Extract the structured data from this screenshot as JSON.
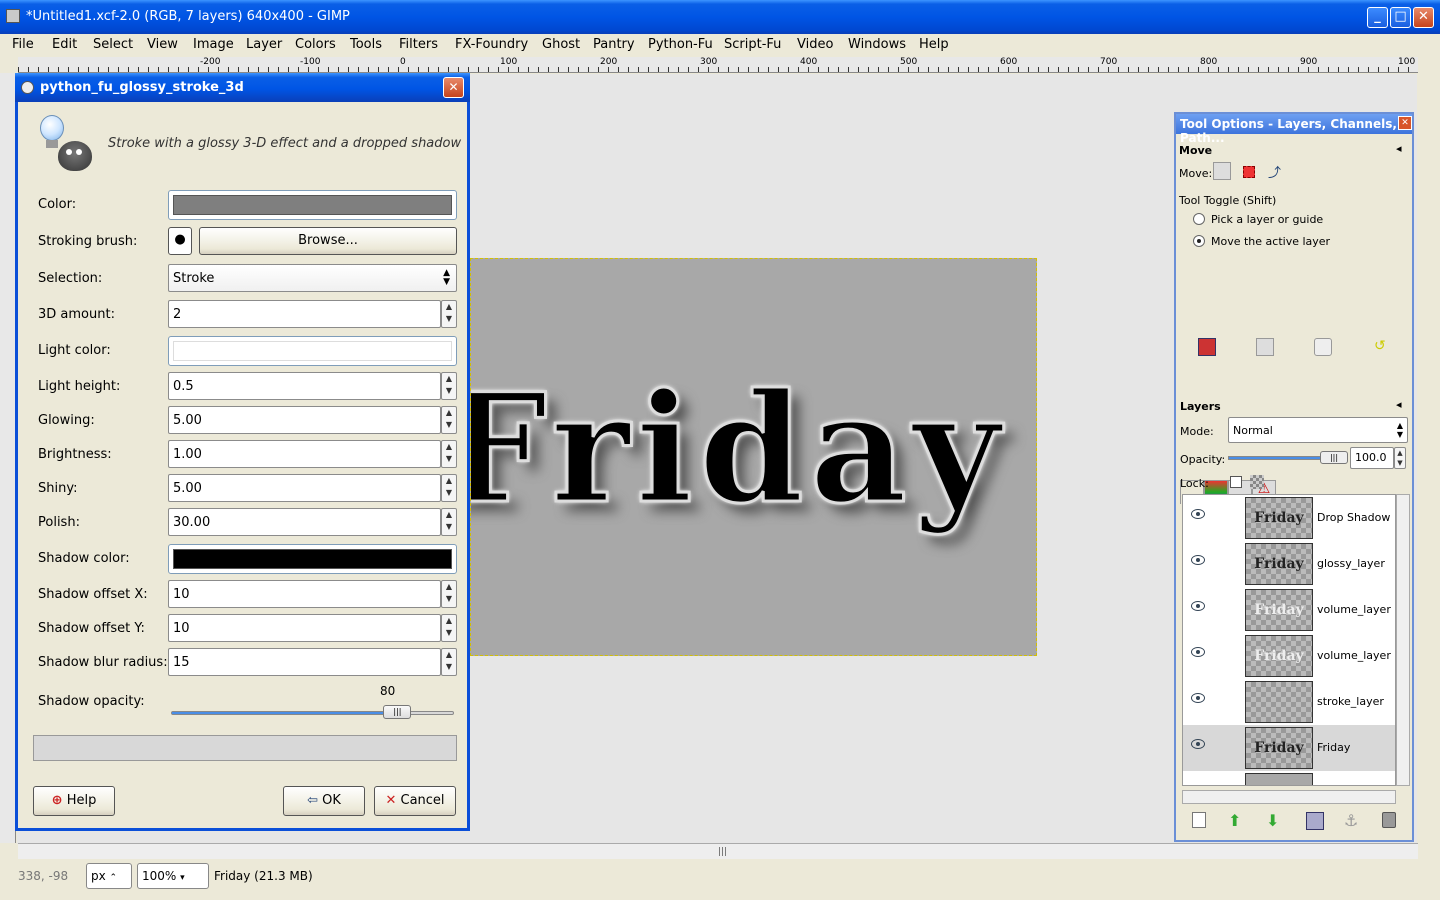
{
  "window": {
    "title": "*Untitled1.xcf-2.0 (RGB, 7 layers) 640x400 - GIMP",
    "min_glyph": "_",
    "max_glyph": "□",
    "close_glyph": "✕"
  },
  "menu": [
    "File",
    "Edit",
    "Select",
    "View",
    "Image",
    "Layer",
    "Colors",
    "Tools",
    "Filters",
    "FX-Foundry",
    "Ghost",
    "Pantry",
    "Python-Fu",
    "Script-Fu",
    "Video",
    "Windows",
    "Help"
  ],
  "ruler": {
    "labels": [
      "-200",
      "-100",
      "0",
      "100",
      "200",
      "300",
      "400",
      "500",
      "600",
      "700",
      "800",
      "900",
      "100"
    ]
  },
  "canvas": {
    "image_text": "Friday"
  },
  "dialog": {
    "title": "python_fu_glossy_stroke_3d",
    "close_glyph": "✕",
    "description": "Stroke with a glossy 3-D effect and a dropped shadow",
    "fields": {
      "color_label": "Color:",
      "color_value": "#7f7f7f",
      "brush_label": "Stroking brush:",
      "brush_dot": "●",
      "browse": "Browse...",
      "selection_label": "Selection:",
      "selection_value": "Stroke",
      "amount_label": "3D amount:",
      "amount_value": "2",
      "light_color_label": "Light color:",
      "light_color_value": "#ffffff",
      "light_height_label": "Light height:",
      "light_height_value": "0.5",
      "glowing_label": "Glowing:",
      "glowing_value": "5.00",
      "brightness_label": "Brightness:",
      "brightness_value": "1.00",
      "shiny_label": "Shiny:",
      "shiny_value": "5.00",
      "polish_label": "Polish:",
      "polish_value": "30.00",
      "shadow_color_label": "Shadow color:",
      "shadow_color_value": "#000000",
      "offset_x_label": "Shadow offset X:",
      "offset_x_value": "10",
      "offset_y_label": "Shadow offset Y:",
      "offset_y_value": "10",
      "blur_label": "Shadow blur radius:",
      "blur_value": "15",
      "opacity_label": "Shadow opacity:",
      "opacity_value": "80",
      "opacity_fraction": 0.8
    },
    "buttons": {
      "help": "Help",
      "ok": "OK",
      "cancel": "Cancel"
    }
  },
  "statusbar": {
    "coords": "338, -98",
    "unit": "px",
    "zoom": "100",
    "zoom_suffix": "%",
    "layer_info": "Friday (21.3 MB)"
  },
  "dock": {
    "title": "Tool Options - Layers, Channels, Path...",
    "close_glyph": "✕",
    "tool_name": "Move",
    "move_label": "Move:",
    "toggle_label": "Tool Toggle  (Shift)",
    "radio_pick": "Pick a layer or guide",
    "radio_move": "Move the active layer",
    "layers_title": "Layers",
    "mode_label": "Mode:",
    "mode_value": "Normal",
    "opacity_label": "Opacity:",
    "opacity_value": "100.0",
    "opacity_fraction": 1.0,
    "lock_label": "Lock:",
    "layers": [
      {
        "name": "Drop Shadow",
        "thumb": "Friday"
      },
      {
        "name": "glossy_layer",
        "thumb": "Friday"
      },
      {
        "name": "volume_layer c",
        "thumb": "Friday"
      },
      {
        "name": "volume_layer",
        "thumb": "Friday"
      },
      {
        "name": "stroke_layer",
        "thumb": ""
      },
      {
        "name": "Friday",
        "thumb": "Friday"
      }
    ]
  }
}
